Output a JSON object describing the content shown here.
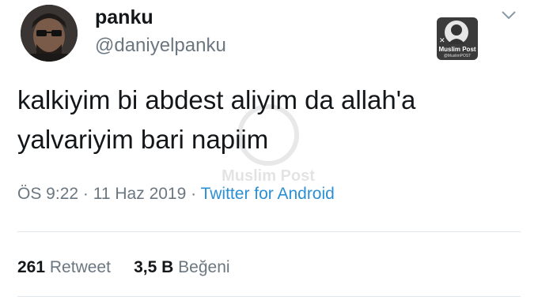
{
  "user": {
    "display_name": "panku",
    "handle": "@daniyelpanku"
  },
  "logo": {
    "name": "Muslim Post",
    "sub": "@MuslimPOST"
  },
  "tweet": {
    "lines": [
      "kalkiyim bi abdest aliyim da allah'a",
      "yalvariyim bari napiim"
    ],
    "time": "ÖS 9:22",
    "date": "11 Haz 2019",
    "source": "Twitter for Android",
    "separator": "·"
  },
  "watermark": {
    "text": "Muslim Post"
  },
  "stats": {
    "retweets_count": "261",
    "retweets_label": "Retweet",
    "likes_count": "3,5 B",
    "likes_label": "Beğeni"
  },
  "colors": {
    "link": "#2a8fd4",
    "muted": "#6b7780",
    "text": "#14171a"
  }
}
